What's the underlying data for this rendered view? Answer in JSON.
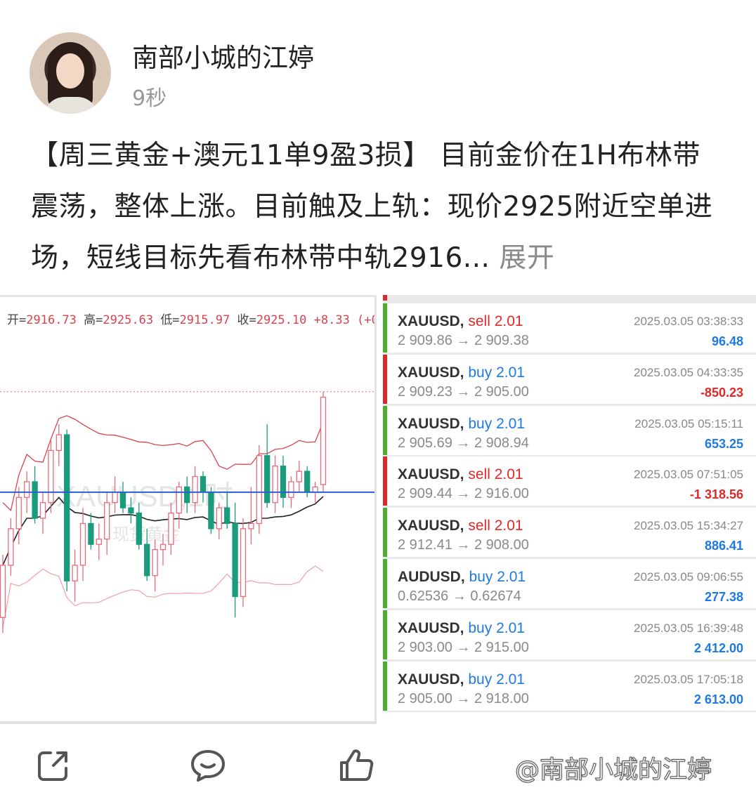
{
  "author": {
    "name": "南部小城的江婷",
    "time": "9秒"
  },
  "post": {
    "text": "【周三黄金+澳元11单9盈3损】 目前金价在1H布林带震荡，整体上涨。目前触及上轨：现价2925附近空单进场，短线目标先看布林带中轨2916...",
    "expand_label": "展开"
  },
  "chart": {
    "open_label": "开=",
    "open": "2916.73",
    "high_label": "高=",
    "high": "2925.63",
    "low_label": "低=",
    "low": "2915.97",
    "close_label": "收=",
    "close": "2925.10",
    "change": "+8.33 (+0",
    "watermark_symbol": "XAUUSD,1时",
    "watermark_name": "现货黄金",
    "colors": {
      "up": "#e86b7a",
      "down": "#1a9b7c",
      "mid_band": "#222222",
      "bands": "#f0a0a8",
      "price_line": "#2c5fd6"
    }
  },
  "chart_data": {
    "type": "candlestick",
    "symbol": "XAUUSD,1时",
    "candles": [
      {
        "o": 2904.0,
        "h": 2910.0,
        "l": 2902.5,
        "c": 2909.0
      },
      {
        "o": 2909.0,
        "h": 2913.5,
        "l": 2908.0,
        "c": 2912.5
      },
      {
        "o": 2912.5,
        "h": 2916.5,
        "l": 2911.0,
        "c": 2915.5
      },
      {
        "o": 2915.5,
        "h": 2918.0,
        "l": 2914.0,
        "c": 2917.0
      },
      {
        "o": 2917.0,
        "h": 2918.5,
        "l": 2913.0,
        "c": 2913.5
      },
      {
        "o": 2913.5,
        "h": 2916.0,
        "l": 2912.0,
        "c": 2915.0
      },
      {
        "o": 2915.0,
        "h": 2921.0,
        "l": 2914.0,
        "c": 2920.0
      },
      {
        "o": 2920.0,
        "h": 2922.5,
        "l": 2918.5,
        "c": 2921.5
      },
      {
        "o": 2921.5,
        "h": 2922.0,
        "l": 2906.5,
        "c": 2907.5
      },
      {
        "o": 2907.5,
        "h": 2910.5,
        "l": 2905.5,
        "c": 2909.0
      },
      {
        "o": 2909.0,
        "h": 2914.5,
        "l": 2907.5,
        "c": 2913.0
      },
      {
        "o": 2913.0,
        "h": 2914.0,
        "l": 2910.5,
        "c": 2911.0
      },
      {
        "o": 2911.0,
        "h": 2913.0,
        "l": 2909.5,
        "c": 2911.5
      },
      {
        "o": 2911.5,
        "h": 2916.0,
        "l": 2910.0,
        "c": 2915.0
      },
      {
        "o": 2915.0,
        "h": 2917.5,
        "l": 2914.0,
        "c": 2916.0
      },
      {
        "o": 2916.0,
        "h": 2917.0,
        "l": 2914.0,
        "c": 2914.5
      },
      {
        "o": 2914.5,
        "h": 2915.5,
        "l": 2913.0,
        "c": 2914.0
      },
      {
        "o": 2914.0,
        "h": 2915.0,
        "l": 2910.5,
        "c": 2911.0
      },
      {
        "o": 2911.0,
        "h": 2912.5,
        "l": 2907.5,
        "c": 2908.0
      },
      {
        "o": 2908.0,
        "h": 2911.5,
        "l": 2906.5,
        "c": 2910.5
      },
      {
        "o": 2910.5,
        "h": 2912.0,
        "l": 2909.0,
        "c": 2911.0
      },
      {
        "o": 2911.0,
        "h": 2915.0,
        "l": 2910.0,
        "c": 2914.0
      },
      {
        "o": 2914.0,
        "h": 2917.0,
        "l": 2912.5,
        "c": 2916.5
      },
      {
        "o": 2916.5,
        "h": 2917.5,
        "l": 2914.0,
        "c": 2915.0
      },
      {
        "o": 2915.0,
        "h": 2918.5,
        "l": 2914.0,
        "c": 2917.5
      },
      {
        "o": 2917.5,
        "h": 2918.0,
        "l": 2915.0,
        "c": 2916.0
      },
      {
        "o": 2916.0,
        "h": 2916.5,
        "l": 2912.0,
        "c": 2912.5
      },
      {
        "o": 2912.5,
        "h": 2915.0,
        "l": 2911.5,
        "c": 2914.5
      },
      {
        "o": 2914.5,
        "h": 2916.0,
        "l": 2912.5,
        "c": 2913.0
      },
      {
        "o": 2913.0,
        "h": 2915.0,
        "l": 2904.0,
        "c": 2906.0
      },
      {
        "o": 2906.0,
        "h": 2913.5,
        "l": 2905.0,
        "c": 2912.5
      },
      {
        "o": 2912.5,
        "h": 2916.5,
        "l": 2911.0,
        "c": 2913.0
      },
      {
        "o": 2913.0,
        "h": 2920.5,
        "l": 2912.0,
        "c": 2919.5
      },
      {
        "o": 2919.5,
        "h": 2922.5,
        "l": 2914.5,
        "c": 2915.0
      },
      {
        "o": 2915.0,
        "h": 2919.5,
        "l": 2914.0,
        "c": 2918.5
      },
      {
        "o": 2918.5,
        "h": 2919.5,
        "l": 2914.5,
        "c": 2915.5
      },
      {
        "o": 2915.5,
        "h": 2917.5,
        "l": 2914.5,
        "c": 2917.0
      },
      {
        "o": 2917.0,
        "h": 2919.0,
        "l": 2916.0,
        "c": 2918.0
      },
      {
        "o": 2918.0,
        "h": 2918.5,
        "l": 2915.5,
        "c": 2916.0
      },
      {
        "o": 2916.0,
        "h": 2917.0,
        "l": 2915.0,
        "c": 2916.5
      },
      {
        "o": 2916.73,
        "h": 2925.63,
        "l": 2915.97,
        "c": 2925.1
      }
    ],
    "current_price": 2916.0,
    "ylim": [
      2895,
      2932
    ]
  },
  "trades": [
    {
      "symbol": "XAUUSD,",
      "side": "sell",
      "volume": "2.01",
      "prices": "2 909.86 → 2 909.38",
      "time": "2025.03.05 03:38:33",
      "profit": "96.48",
      "positive": true
    },
    {
      "symbol": "XAUUSD,",
      "side": "buy",
      "volume": "2.01",
      "prices": "2 909.23 → 2 905.00",
      "time": "2025.03.05 04:33:35",
      "profit": "-850.23",
      "positive": false
    },
    {
      "symbol": "XAUUSD,",
      "side": "buy",
      "volume": "2.01",
      "prices": "2 905.69 → 2 908.94",
      "time": "2025.03.05 05:15:11",
      "profit": "653.25",
      "positive": true
    },
    {
      "symbol": "XAUUSD,",
      "side": "sell",
      "volume": "2.01",
      "prices": "2 909.44 → 2 916.00",
      "time": "2025.03.05 07:51:05",
      "profit": "-1 318.56",
      "positive": false
    },
    {
      "symbol": "XAUUSD,",
      "side": "sell",
      "volume": "2.01",
      "prices": "2 912.41 → 2 908.00",
      "time": "2025.03.05 15:34:27",
      "profit": "886.41",
      "positive": true
    },
    {
      "symbol": "AUDUSD,",
      "side": "buy",
      "volume": "2.01",
      "prices": "0.62536 → 0.62674",
      "time": "2025.03.05 09:06:55",
      "profit": "277.38",
      "positive": true
    },
    {
      "symbol": "XAUUSD,",
      "side": "buy",
      "volume": "2.01",
      "prices": "2 903.00 → 2 915.00",
      "time": "2025.03.05 16:39:48",
      "profit": "2 412.00",
      "positive": true
    },
    {
      "symbol": "XAUUSD,",
      "side": "buy",
      "volume": "2.01",
      "prices": "2 905.00 → 2 918.00",
      "time": "2025.03.05 17:05:18",
      "profit": "2 613.00",
      "positive": true
    }
  ],
  "trade_colors": {
    "win_bar": "#4caf2a",
    "loss_bar": "#e02828",
    "sell": "#e02828",
    "buy": "#1f7ae0",
    "profit": "#1f7ae0",
    "loss": "#e02828"
  },
  "actions": {
    "share_icon": "share-icon",
    "comment_icon": "comment-icon",
    "like_icon": "like-icon"
  },
  "watermark": "@南部小城的江婷"
}
